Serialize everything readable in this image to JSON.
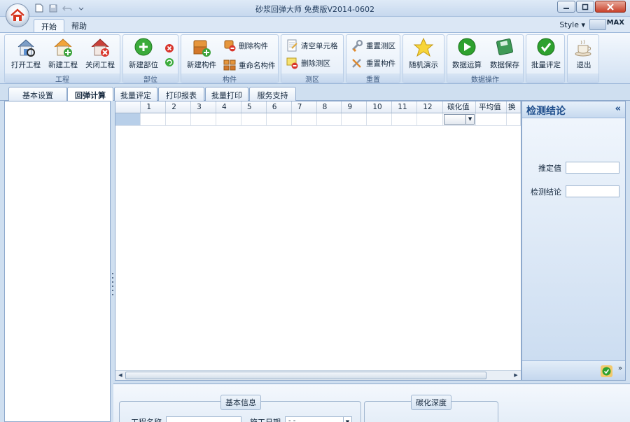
{
  "window": {
    "title": "砂浆回弹大师 免费版V2014-0602",
    "style_label": "Style",
    "max_label": "MAX"
  },
  "ribbon_tabs": [
    "开始",
    "帮助"
  ],
  "ribbon": {
    "groups": {
      "project": "工程",
      "part": "部位",
      "component": "构件",
      "zone": "测区",
      "reset": "重置",
      "data_ops": "数据操作"
    },
    "buttons": {
      "open_project": "打开工程",
      "new_project": "新建工程",
      "close_project": "关闭工程",
      "new_part": "新建部位",
      "new_component": "新建构件",
      "delete_component": "删除构件",
      "rename_component": "重命名构件",
      "clear_cells": "清空单元格",
      "delete_zone": "删除测区",
      "reset_zone": "重置测区",
      "reset_component": "重置构件",
      "random_demo": "随机演示",
      "data_compute": "数据运算",
      "data_save": "数据保存",
      "batch_evaluate": "批量评定",
      "exit": "退出"
    }
  },
  "content_tabs": [
    "基本设置",
    "回弹计算",
    "批量评定",
    "打印报表",
    "批量打印",
    "服务支持"
  ],
  "grid": {
    "columns": [
      "",
      "1",
      "2",
      "3",
      "4",
      "5",
      "6",
      "7",
      "8",
      "9",
      "10",
      "11",
      "12",
      "碳化值",
      "平均值",
      "换"
    ]
  },
  "right_panel": {
    "title": "检测结论",
    "collapse_glyph": "«",
    "fields": [
      {
        "label": "推定值",
        "value": ""
      },
      {
        "label": "检测结论",
        "value": ""
      }
    ]
  },
  "bottom": {
    "basic_info_legend": "基本信息",
    "carbonation_legend": "碳化深度",
    "project_name_label": "工程名称",
    "construction_date_label": "施工日期",
    "construction_date_value": "-  -"
  }
}
